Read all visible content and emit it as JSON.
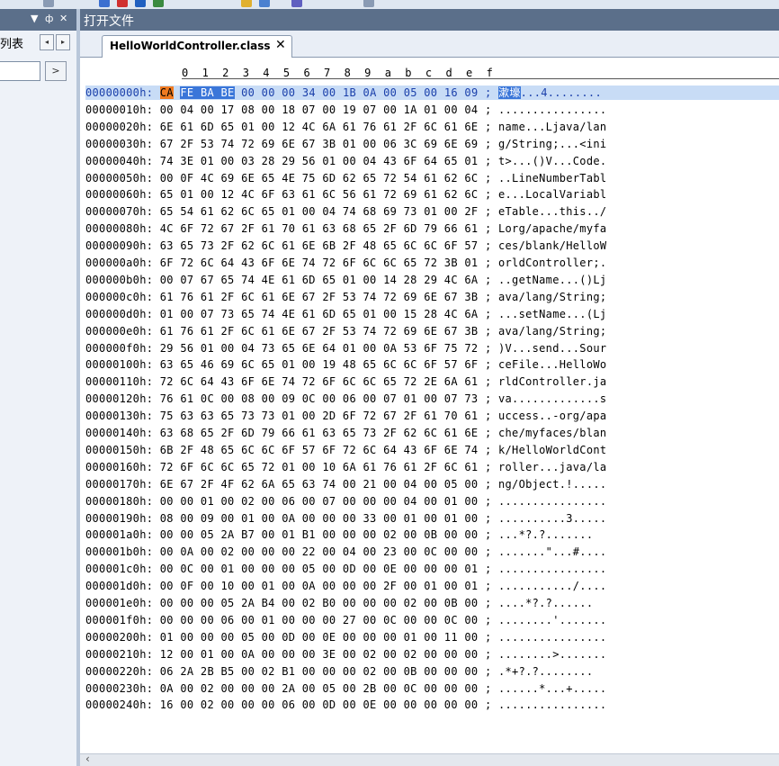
{
  "toolbar": {
    "icons": [
      "dropdown-arrow-icon",
      "save-icon",
      "word-icon",
      "chart-icon",
      "folder-icon",
      "image-icon",
      "compare-icon",
      "settings-icon",
      "dropdown-arrow-icon"
    ]
  },
  "left_panel": {
    "title_controls": {
      "collapse": "▼",
      "pin": "ф",
      "close": "✕"
    },
    "list_label": "列表",
    "nav_prev": "◂",
    "nav_next": "▸",
    "go_button": ">"
  },
  "document": {
    "title": "打开文件",
    "tab_label": "HelloWorldController.class",
    "tab_close": "✕"
  },
  "hex": {
    "ruler": "0  1  2  3  4  5  6  7  8  9  a  b  c  d  e  f",
    "selected_row": {
      "address": "00000000h:",
      "cursor_byte": "CA",
      "selected_bytes": "FE BA BE",
      "rest_bytes": "00 00 00 34 00 1B 0A 00 05 00 16 09 ;",
      "selected_ascii": "漱壕",
      "rest_ascii": "...4........"
    },
    "rows": [
      "00000010h: 00 04 00 17 08 00 18 07 00 19 07 00 1A 01 00 04 ; ................",
      "00000020h: 6E 61 6D 65 01 00 12 4C 6A 61 76 61 2F 6C 61 6E ; name...Ljava/lan",
      "00000030h: 67 2F 53 74 72 69 6E 67 3B 01 00 06 3C 69 6E 69 ; g/String;...<ini",
      "00000040h: 74 3E 01 00 03 28 29 56 01 00 04 43 6F 64 65 01 ; t>...()V...Code.",
      "00000050h: 00 0F 4C 69 6E 65 4E 75 6D 62 65 72 54 61 62 6C ; ..LineNumberTabl",
      "00000060h: 65 01 00 12 4C 6F 63 61 6C 56 61 72 69 61 62 6C ; e...LocalVariabl",
      "00000070h: 65 54 61 62 6C 65 01 00 04 74 68 69 73 01 00 2F ; eTable...this../",
      "00000080h: 4C 6F 72 67 2F 61 70 61 63 68 65 2F 6D 79 66 61 ; Lorg/apache/myfa",
      "00000090h: 63 65 73 2F 62 6C 61 6E 6B 2F 48 65 6C 6C 6F 57 ; ces/blank/HelloW",
      "000000a0h: 6F 72 6C 64 43 6F 6E 74 72 6F 6C 6C 65 72 3B 01 ; orldController;.",
      "000000b0h: 00 07 67 65 74 4E 61 6D 65 01 00 14 28 29 4C 6A ; ..getName...()Lj",
      "000000c0h: 61 76 61 2F 6C 61 6E 67 2F 53 74 72 69 6E 67 3B ; ava/lang/String;",
      "000000d0h: 01 00 07 73 65 74 4E 61 6D 65 01 00 15 28 4C 6A ; ...setName...(Lj",
      "000000e0h: 61 76 61 2F 6C 61 6E 67 2F 53 74 72 69 6E 67 3B ; ava/lang/String;",
      "000000f0h: 29 56 01 00 04 73 65 6E 64 01 00 0A 53 6F 75 72 ; )V...send...Sour",
      "00000100h: 63 65 46 69 6C 65 01 00 19 48 65 6C 6C 6F 57 6F ; ceFile...HelloWo",
      "00000110h: 72 6C 64 43 6F 6E 74 72 6F 6C 6C 65 72 2E 6A 61 ; rldController.ja",
      "00000120h: 76 61 0C 00 08 00 09 0C 00 06 00 07 01 00 07 73 ; va.............s",
      "00000130h: 75 63 63 65 73 73 01 00 2D 6F 72 67 2F 61 70 61 ; uccess..-org/apa",
      "00000140h: 63 68 65 2F 6D 79 66 61 63 65 73 2F 62 6C 61 6E ; che/myfaces/blan",
      "00000150h: 6B 2F 48 65 6C 6C 6F 57 6F 72 6C 64 43 6F 6E 74 ; k/HelloWorldCont",
      "00000160h: 72 6F 6C 6C 65 72 01 00 10 6A 61 76 61 2F 6C 61 ; roller...java/la",
      "00000170h: 6E 67 2F 4F 62 6A 65 63 74 00 21 00 04 00 05 00 ; ng/Object.!.....",
      "00000180h: 00 00 01 00 02 00 06 00 07 00 00 00 04 00 01 00 ; ................",
      "00000190h: 08 00 09 00 01 00 0A 00 00 00 33 00 01 00 01 00 ; ..........3.....",
      "000001a0h: 00 00 05 2A B7 00 01 B1 00 00 00 02 00 0B 00 00 ; ...*?.?.......",
      "000001b0h: 00 0A 00 02 00 00 00 22 00 04 00 23 00 0C 00 00 ; .......\"...#....",
      "000001c0h: 00 0C 00 01 00 00 00 05 00 0D 00 0E 00 00 00 01 ; ................",
      "000001d0h: 00 0F 00 10 00 01 00 0A 00 00 00 2F 00 01 00 01 ; .........../....",
      "000001e0h: 00 00 00 05 2A B4 00 02 B0 00 00 00 02 00 0B 00 ; ....*?.?......",
      "000001f0h: 00 00 00 06 00 01 00 00 00 27 00 0C 00 00 0C 00 ; ........'.......",
      "00000200h: 01 00 00 00 05 00 0D 00 0E 00 00 00 01 00 11 00 ; ................",
      "00000210h: 12 00 01 00 0A 00 00 00 3E 00 02 00 02 00 00 00 ; ........>.......",
      "00000220h: 06 2A 2B B5 00 02 B1 00 00 00 02 00 0B 00 00 00 ; .*+?.?........",
      "00000230h: 0A 00 02 00 00 00 2A 00 05 00 2B 00 0C 00 00 00 ; ......*...+.....",
      "00000240h: 16 00 02 00 00 00 06 00 0D 00 0E 00 00 00 00 00 ; ................"
    ]
  },
  "scrollbar": {
    "left_arrow": "‹"
  }
}
